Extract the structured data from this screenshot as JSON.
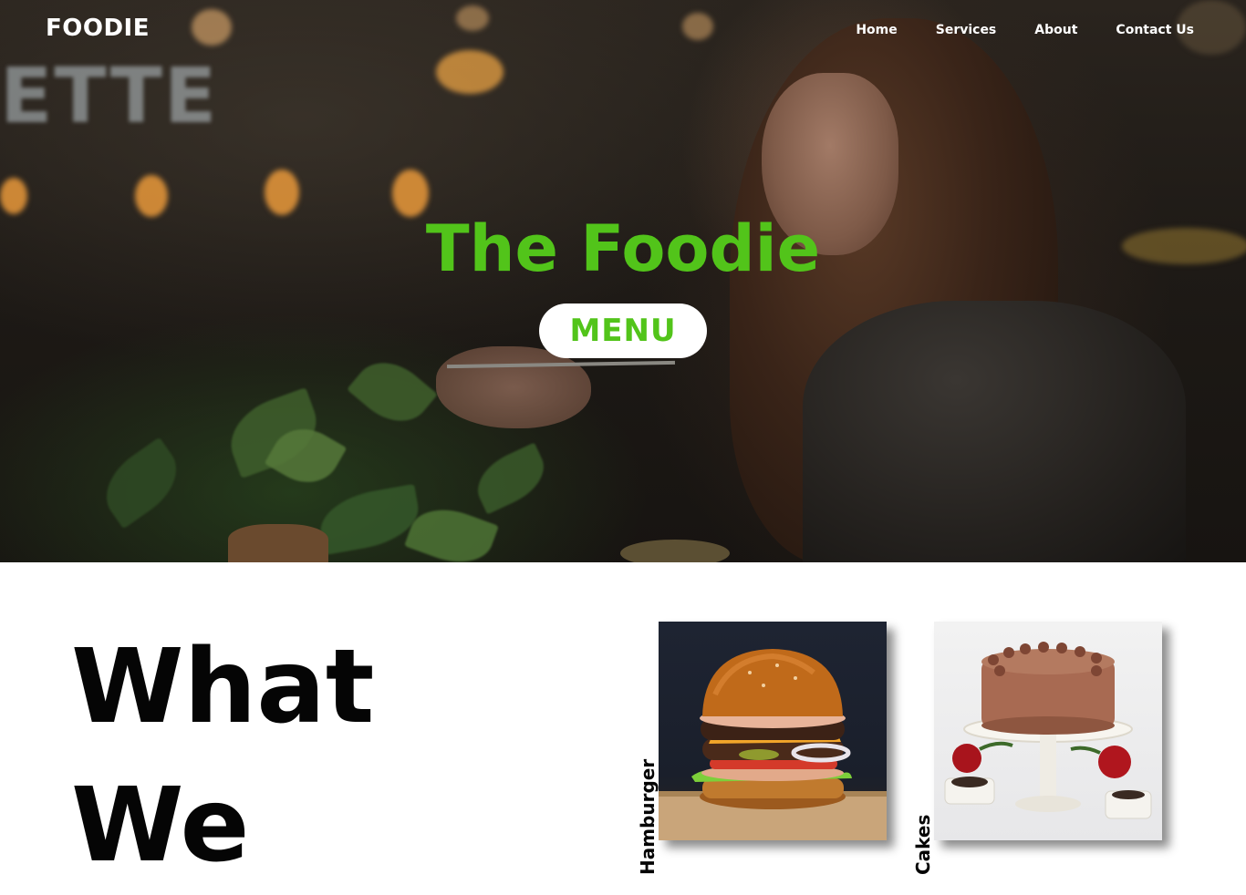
{
  "header": {
    "brand": "FOODIE",
    "nav": [
      {
        "label": "Home"
      },
      {
        "label": "Services"
      },
      {
        "label": "About"
      },
      {
        "label": "Contact Us"
      }
    ]
  },
  "hero": {
    "title": "The Foodie",
    "menu_button": "MENU",
    "background_sign_text": "ETTE",
    "background_icon": "woman-eating-photo"
  },
  "services": {
    "heading_line1": "What",
    "heading_line2": "We",
    "cards": [
      {
        "label": "Hamburger",
        "image": "burger-photo"
      },
      {
        "label": "Cakes",
        "image": "cake-photo"
      }
    ]
  },
  "colors": {
    "accent": "#52c41a",
    "text_dark": "#050505",
    "nav_text": "#ffffff"
  }
}
